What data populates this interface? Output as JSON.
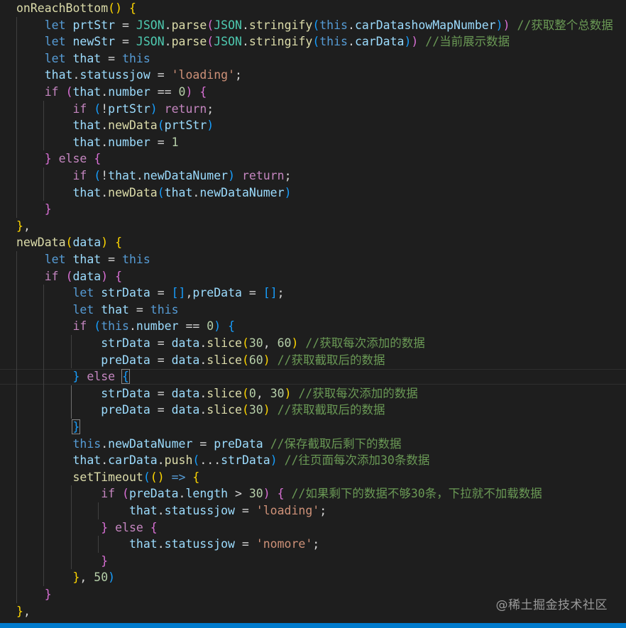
{
  "code": {
    "lines": [
      [
        [
          "onReachBottom",
          "fn"
        ],
        [
          "()",
          "b1"
        ],
        [
          " ",
          "p"
        ],
        [
          "{",
          "b1"
        ]
      ],
      [
        [
          "    ",
          "p"
        ],
        [
          "let",
          "kw"
        ],
        [
          " ",
          "p"
        ],
        [
          "prtStr",
          "var"
        ],
        [
          " = ",
          "p"
        ],
        [
          "JSON",
          "cls"
        ],
        [
          ".",
          "p"
        ],
        [
          "parse",
          "fn"
        ],
        [
          "(",
          "b2"
        ],
        [
          "JSON",
          "cls"
        ],
        [
          ".",
          "p"
        ],
        [
          "stringify",
          "fn"
        ],
        [
          "(",
          "b3"
        ],
        [
          "this",
          "kw"
        ],
        [
          ".",
          "p"
        ],
        [
          "carDatashowMapNumber",
          "var"
        ],
        [
          ")",
          "b3"
        ],
        [
          ")",
          "b2"
        ],
        [
          " ",
          "p"
        ],
        [
          "//获取整个总数据",
          "cmt"
        ]
      ],
      [
        [
          "    ",
          "p"
        ],
        [
          "let",
          "kw"
        ],
        [
          " ",
          "p"
        ],
        [
          "newStr",
          "var"
        ],
        [
          " = ",
          "p"
        ],
        [
          "JSON",
          "cls"
        ],
        [
          ".",
          "p"
        ],
        [
          "parse",
          "fn"
        ],
        [
          "(",
          "b2"
        ],
        [
          "JSON",
          "cls"
        ],
        [
          ".",
          "p"
        ],
        [
          "stringify",
          "fn"
        ],
        [
          "(",
          "b3"
        ],
        [
          "this",
          "kw"
        ],
        [
          ".",
          "p"
        ],
        [
          "carData",
          "var"
        ],
        [
          ")",
          "b3"
        ],
        [
          ")",
          "b2"
        ],
        [
          " ",
          "p"
        ],
        [
          "//当前展示数据",
          "cmt"
        ]
      ],
      [
        [
          "    ",
          "p"
        ],
        [
          "let",
          "kw"
        ],
        [
          " ",
          "p"
        ],
        [
          "that",
          "var"
        ],
        [
          " = ",
          "p"
        ],
        [
          "this",
          "kw"
        ]
      ],
      [
        [
          "    ",
          "p"
        ],
        [
          "that",
          "var"
        ],
        [
          ".",
          "p"
        ],
        [
          "statussjow",
          "var"
        ],
        [
          " = ",
          "p"
        ],
        [
          "'loading'",
          "str"
        ],
        [
          ";",
          "p"
        ]
      ],
      [
        [
          "    ",
          "p"
        ],
        [
          "if",
          "ctl"
        ],
        [
          " ",
          "p"
        ],
        [
          "(",
          "b2"
        ],
        [
          "that",
          "var"
        ],
        [
          ".",
          "p"
        ],
        [
          "number",
          "var"
        ],
        [
          " == ",
          "p"
        ],
        [
          "0",
          "num"
        ],
        [
          ")",
          "b2"
        ],
        [
          " ",
          "p"
        ],
        [
          "{",
          "b2"
        ]
      ],
      [
        [
          "        ",
          "p"
        ],
        [
          "if",
          "ctl"
        ],
        [
          " ",
          "p"
        ],
        [
          "(",
          "b3"
        ],
        [
          "!",
          "p"
        ],
        [
          "prtStr",
          "var"
        ],
        [
          ")",
          "b3"
        ],
        [
          " ",
          "p"
        ],
        [
          "return",
          "ctl"
        ],
        [
          ";",
          "p"
        ]
      ],
      [
        [
          "        ",
          "p"
        ],
        [
          "that",
          "var"
        ],
        [
          ".",
          "p"
        ],
        [
          "newData",
          "fn"
        ],
        [
          "(",
          "b3"
        ],
        [
          "prtStr",
          "var"
        ],
        [
          ")",
          "b3"
        ]
      ],
      [
        [
          "        ",
          "p"
        ],
        [
          "that",
          "var"
        ],
        [
          ".",
          "p"
        ],
        [
          "number",
          "var"
        ],
        [
          " = ",
          "p"
        ],
        [
          "1",
          "num"
        ]
      ],
      [
        [
          "    ",
          "p"
        ],
        [
          "}",
          "b2"
        ],
        [
          " ",
          "p"
        ],
        [
          "else",
          "ctl"
        ],
        [
          " ",
          "p"
        ],
        [
          "{",
          "b2"
        ]
      ],
      [
        [
          "        ",
          "p"
        ],
        [
          "if",
          "ctl"
        ],
        [
          " ",
          "p"
        ],
        [
          "(",
          "b3"
        ],
        [
          "!",
          "p"
        ],
        [
          "that",
          "var"
        ],
        [
          ".",
          "p"
        ],
        [
          "newDataNumer",
          "var"
        ],
        [
          ")",
          "b3"
        ],
        [
          " ",
          "p"
        ],
        [
          "return",
          "ctl"
        ],
        [
          ";",
          "p"
        ]
      ],
      [
        [
          "        ",
          "p"
        ],
        [
          "that",
          "var"
        ],
        [
          ".",
          "p"
        ],
        [
          "newData",
          "fn"
        ],
        [
          "(",
          "b3"
        ],
        [
          "that",
          "var"
        ],
        [
          ".",
          "p"
        ],
        [
          "newDataNumer",
          "var"
        ],
        [
          ")",
          "b3"
        ]
      ],
      [
        [
          "    ",
          "p"
        ],
        [
          "}",
          "b2"
        ]
      ],
      [
        [
          "}",
          "b1"
        ],
        [
          ",",
          "p"
        ]
      ],
      [
        [
          "newData",
          "fn"
        ],
        [
          "(",
          "b1"
        ],
        [
          "data",
          "var"
        ],
        [
          ")",
          "b1"
        ],
        [
          " ",
          "p"
        ],
        [
          "{",
          "b1"
        ]
      ],
      [
        [
          "    ",
          "p"
        ],
        [
          "let",
          "kw"
        ],
        [
          " ",
          "p"
        ],
        [
          "that",
          "var"
        ],
        [
          " = ",
          "p"
        ],
        [
          "this",
          "kw"
        ]
      ],
      [
        [
          "    ",
          "p"
        ],
        [
          "if",
          "ctl"
        ],
        [
          " ",
          "p"
        ],
        [
          "(",
          "b2"
        ],
        [
          "data",
          "var"
        ],
        [
          ")",
          "b2"
        ],
        [
          " ",
          "p"
        ],
        [
          "{",
          "b2"
        ]
      ],
      [
        [
          "        ",
          "p"
        ],
        [
          "let",
          "kw"
        ],
        [
          " ",
          "p"
        ],
        [
          "strData",
          "var"
        ],
        [
          " = ",
          "p"
        ],
        [
          "[]",
          "b3"
        ],
        [
          ",",
          "p"
        ],
        [
          "preData",
          "var"
        ],
        [
          " = ",
          "p"
        ],
        [
          "[]",
          "b3"
        ],
        [
          ";",
          "p"
        ]
      ],
      [
        [
          "        ",
          "p"
        ],
        [
          "let",
          "kw"
        ],
        [
          " ",
          "p"
        ],
        [
          "that",
          "var"
        ],
        [
          " = ",
          "p"
        ],
        [
          "this",
          "kw"
        ]
      ],
      [
        [
          "        ",
          "p"
        ],
        [
          "if",
          "ctl"
        ],
        [
          " ",
          "p"
        ],
        [
          "(",
          "b3"
        ],
        [
          "this",
          "kw"
        ],
        [
          ".",
          "p"
        ],
        [
          "number",
          "var"
        ],
        [
          " == ",
          "p"
        ],
        [
          "0",
          "num"
        ],
        [
          ")",
          "b3"
        ],
        [
          " ",
          "p"
        ],
        [
          "{",
          "b3"
        ]
      ],
      [
        [
          "            ",
          "p"
        ],
        [
          "strData",
          "var"
        ],
        [
          " = ",
          "p"
        ],
        [
          "data",
          "var"
        ],
        [
          ".",
          "p"
        ],
        [
          "slice",
          "fn"
        ],
        [
          "(",
          "b1"
        ],
        [
          "30",
          "num"
        ],
        [
          ", ",
          "p"
        ],
        [
          "60",
          "num"
        ],
        [
          ")",
          "b1"
        ],
        [
          " ",
          "p"
        ],
        [
          "//获取每次添加的数据",
          "cmt"
        ]
      ],
      [
        [
          "            ",
          "p"
        ],
        [
          "preData",
          "var"
        ],
        [
          " = ",
          "p"
        ],
        [
          "data",
          "var"
        ],
        [
          ".",
          "p"
        ],
        [
          "slice",
          "fn"
        ],
        [
          "(",
          "b1"
        ],
        [
          "60",
          "num"
        ],
        [
          ")",
          "b1"
        ],
        [
          " ",
          "p"
        ],
        [
          "//获取截取后的数据",
          "cmt"
        ]
      ],
      [
        [
          "        ",
          "p"
        ],
        [
          "}",
          "b3"
        ],
        [
          " ",
          "p"
        ],
        [
          "else",
          "ctl"
        ],
        [
          " ",
          "p"
        ],
        [
          "{",
          "b3m"
        ]
      ],
      [
        [
          "            ",
          "p"
        ],
        [
          "strData",
          "var"
        ],
        [
          " = ",
          "p"
        ],
        [
          "data",
          "var"
        ],
        [
          ".",
          "p"
        ],
        [
          "slice",
          "fn"
        ],
        [
          "(",
          "b1"
        ],
        [
          "0",
          "num"
        ],
        [
          ", ",
          "p"
        ],
        [
          "30",
          "num"
        ],
        [
          ")",
          "b1"
        ],
        [
          " ",
          "p"
        ],
        [
          "//获取每次添加的数据",
          "cmt"
        ]
      ],
      [
        [
          "            ",
          "p"
        ],
        [
          "preData",
          "var"
        ],
        [
          " = ",
          "p"
        ],
        [
          "data",
          "var"
        ],
        [
          ".",
          "p"
        ],
        [
          "slice",
          "fn"
        ],
        [
          "(",
          "b1"
        ],
        [
          "30",
          "num"
        ],
        [
          ")",
          "b1"
        ],
        [
          " ",
          "p"
        ],
        [
          "//获取截取后的数据",
          "cmt"
        ]
      ],
      [
        [
          "        ",
          "p"
        ],
        [
          "}",
          "b3m"
        ]
      ],
      [
        [
          "        ",
          "p"
        ],
        [
          "this",
          "kw"
        ],
        [
          ".",
          "p"
        ],
        [
          "newDataNumer",
          "var"
        ],
        [
          " = ",
          "p"
        ],
        [
          "preData",
          "var"
        ],
        [
          " ",
          "p"
        ],
        [
          "//保存截取后剩下的数据",
          "cmt"
        ]
      ],
      [
        [
          "        ",
          "p"
        ],
        [
          "that",
          "var"
        ],
        [
          ".",
          "p"
        ],
        [
          "carData",
          "var"
        ],
        [
          ".",
          "p"
        ],
        [
          "push",
          "fn"
        ],
        [
          "(",
          "b3"
        ],
        [
          "...",
          "p"
        ],
        [
          "strData",
          "var"
        ],
        [
          ")",
          "b3"
        ],
        [
          " ",
          "p"
        ],
        [
          "//往页面每次添加30条数据",
          "cmt"
        ]
      ],
      [
        [
          "        ",
          "p"
        ],
        [
          "setTimeout",
          "fn"
        ],
        [
          "(",
          "b3"
        ],
        [
          "()",
          "b1"
        ],
        [
          " ",
          "p"
        ],
        [
          "=>",
          "kw"
        ],
        [
          " ",
          "p"
        ],
        [
          "{",
          "b1"
        ]
      ],
      [
        [
          "            ",
          "p"
        ],
        [
          "if",
          "ctl"
        ],
        [
          " ",
          "p"
        ],
        [
          "(",
          "b2"
        ],
        [
          "preData",
          "var"
        ],
        [
          ".",
          "p"
        ],
        [
          "length",
          "var"
        ],
        [
          " > ",
          "p"
        ],
        [
          "30",
          "num"
        ],
        [
          ")",
          "b2"
        ],
        [
          " ",
          "p"
        ],
        [
          "{",
          "b2"
        ],
        [
          " ",
          "p"
        ],
        [
          "//如果剩下的数据不够30条，下拉就不加载数据",
          "cmt"
        ]
      ],
      [
        [
          "                ",
          "p"
        ],
        [
          "that",
          "var"
        ],
        [
          ".",
          "p"
        ],
        [
          "statussjow",
          "var"
        ],
        [
          " = ",
          "p"
        ],
        [
          "'loading'",
          "str"
        ],
        [
          ";",
          "p"
        ]
      ],
      [
        [
          "            ",
          "p"
        ],
        [
          "}",
          "b2"
        ],
        [
          " ",
          "p"
        ],
        [
          "else",
          "ctl"
        ],
        [
          " ",
          "p"
        ],
        [
          "{",
          "b2"
        ]
      ],
      [
        [
          "                ",
          "p"
        ],
        [
          "that",
          "var"
        ],
        [
          ".",
          "p"
        ],
        [
          "statussjow",
          "var"
        ],
        [
          " = ",
          "p"
        ],
        [
          "'nomore'",
          "str"
        ],
        [
          ";",
          "p"
        ]
      ],
      [
        [
          "            ",
          "p"
        ],
        [
          "}",
          "b2"
        ]
      ],
      [
        [
          "        ",
          "p"
        ],
        [
          "}",
          "b1"
        ],
        [
          ", ",
          "p"
        ],
        [
          "50",
          "num"
        ],
        [
          ")",
          "b3"
        ]
      ],
      [
        [
          "    ",
          "p"
        ],
        [
          "}",
          "b2"
        ]
      ],
      [
        [
          "}",
          "b1"
        ],
        [
          ",",
          "p"
        ]
      ]
    ]
  },
  "watermark": "@稀土掘金技术社区",
  "colors": {
    "background": "#1e1e1e",
    "status_bar": "#007acc"
  }
}
